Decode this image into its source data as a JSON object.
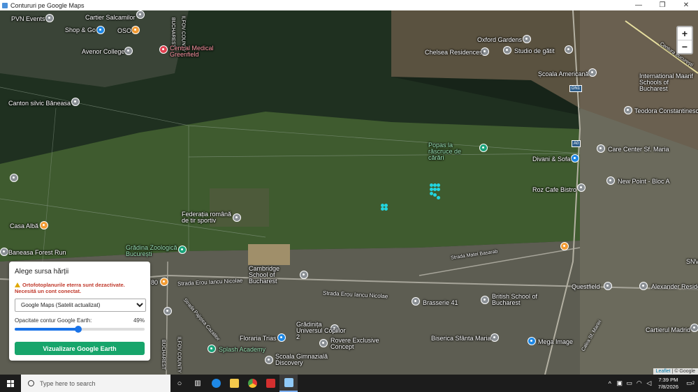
{
  "window": {
    "title": "Contururi pe Google Maps",
    "minimize_icon": "minimize-icon",
    "maximize_icon": "restore-icon",
    "close_icon": "close-icon"
  },
  "map": {
    "zoom_in": "+",
    "zoom_out": "−",
    "attribution_leaflet": "Leaflet",
    "attribution_rest": " | © Google",
    "road_badges": [
      "DN1",
      "A0"
    ],
    "places": [
      {
        "name": "PVN Events",
        "color": "#8a8f94"
      },
      {
        "name": "Cartier Salcamilor",
        "color": "#8a8f94"
      },
      {
        "name": "Shop & Go",
        "color": "#1e88e5"
      },
      {
        "name": "OSO",
        "color": "#f39c34"
      },
      {
        "name": "Avenor College",
        "color": "#8a8f94"
      },
      {
        "name": "Central Medical Greenfield",
        "color": "#e04050"
      },
      {
        "name": "Canton silvic Băneasa",
        "color": "#8a8f94"
      },
      {
        "name": "Oxford Gardens",
        "color": "#8a8f94"
      },
      {
        "name": "Chelsea Residences",
        "color": "#8a8f94"
      },
      {
        "name": "Studio de gătit",
        "color": "#8a8f94"
      },
      {
        "name": "Școala Americană",
        "color": "#8a8f94"
      },
      {
        "name": "International Maarif Schools of Bucharest",
        "color": "#8a8f94"
      },
      {
        "name": "Teodora Constantinescu",
        "color": "#8a8f94"
      },
      {
        "name": "Popas la răscruce de cărări",
        "color": "#1aa37a"
      },
      {
        "name": "Care Center Sf. Maria",
        "color": "#8a8f94"
      },
      {
        "name": "Divani & Sofa",
        "color": "#1e88e5"
      },
      {
        "name": "New Point - Bloc A",
        "color": "#8a8f94"
      },
      {
        "name": "Roz Cafe Bistro",
        "color": "#8a8f94"
      },
      {
        "name": "Casa Albă",
        "color": "#f39c34"
      },
      {
        "name": "Federația română de tir sportiv",
        "color": "#8a8f94"
      },
      {
        "name": "Grădina Zoologică București",
        "color": "#1aa37a"
      },
      {
        "name": "Baneasa Forest Run",
        "color": "#8a8f94"
      },
      {
        "name": "Cambridge School of Bucharest",
        "color": "#8a8f94"
      },
      {
        "name": "Questfield",
        "color": "#8a8f94"
      },
      {
        "name": "Alexander Residence",
        "color": "#8a8f94"
      },
      {
        "name": "Brasserie 41",
        "color": "#8a8f94"
      },
      {
        "name": "British School of Bucharest",
        "color": "#8a8f94"
      },
      {
        "name": "Cartierul Madrid",
        "color": "#8a8f94"
      },
      {
        "name": "Grădinița Universul Copiilor 2",
        "color": "#8a8f94"
      },
      {
        "name": "Floraria Trias",
        "color": "#1e88e5"
      },
      {
        "name": "Rovere Exclusive Concept",
        "color": "#8a8f94"
      },
      {
        "name": "Biserica Sfânta Maria",
        "color": "#8a8f94"
      },
      {
        "name": "Mega Image",
        "color": "#1e88e5"
      },
      {
        "name": "Splash Academy",
        "color": "#1aa37a"
      },
      {
        "name": "Școala Gimnazială Discovery",
        "color": "#8a8f94"
      }
    ],
    "streets": [
      "Strada Erou Iancu Nicolae",
      "Strada Erou Iancu Nicolae",
      "Strada Matei Basarab",
      "Strada Pajiștea Cazalilor",
      "Calea Sf. Mariei",
      "Centura București",
      "BUCHAREST",
      "ILFOV COUNTY",
      "BUCHAREST",
      "ILFOV COUNTY",
      "SNV",
      "80"
    ]
  },
  "panel": {
    "title": "Alege sursa hărții",
    "warning": "Ortofotoplanurile eterra sunt dezactivate. Necesită un cont conectat.",
    "select_value": "Google Maps (Satelit actualizat)",
    "select_options": [
      "Google Maps (Satelit actualizat)"
    ],
    "opacity_label": "Opacitate contur Google Earth:",
    "opacity_value": "49%",
    "opacity_fraction": 0.49,
    "button": "Vizualizare Google Earth"
  },
  "taskbar": {
    "search_placeholder": "Type here to search",
    "time": "7:39 PM",
    "date": "7/8/2026",
    "notification_count": "2",
    "apps": [
      "task-view-icon",
      "widgets-icon",
      "edge-icon",
      "file-explorer-icon",
      "chrome-icon",
      "app-icon",
      "active-window-icon"
    ]
  }
}
